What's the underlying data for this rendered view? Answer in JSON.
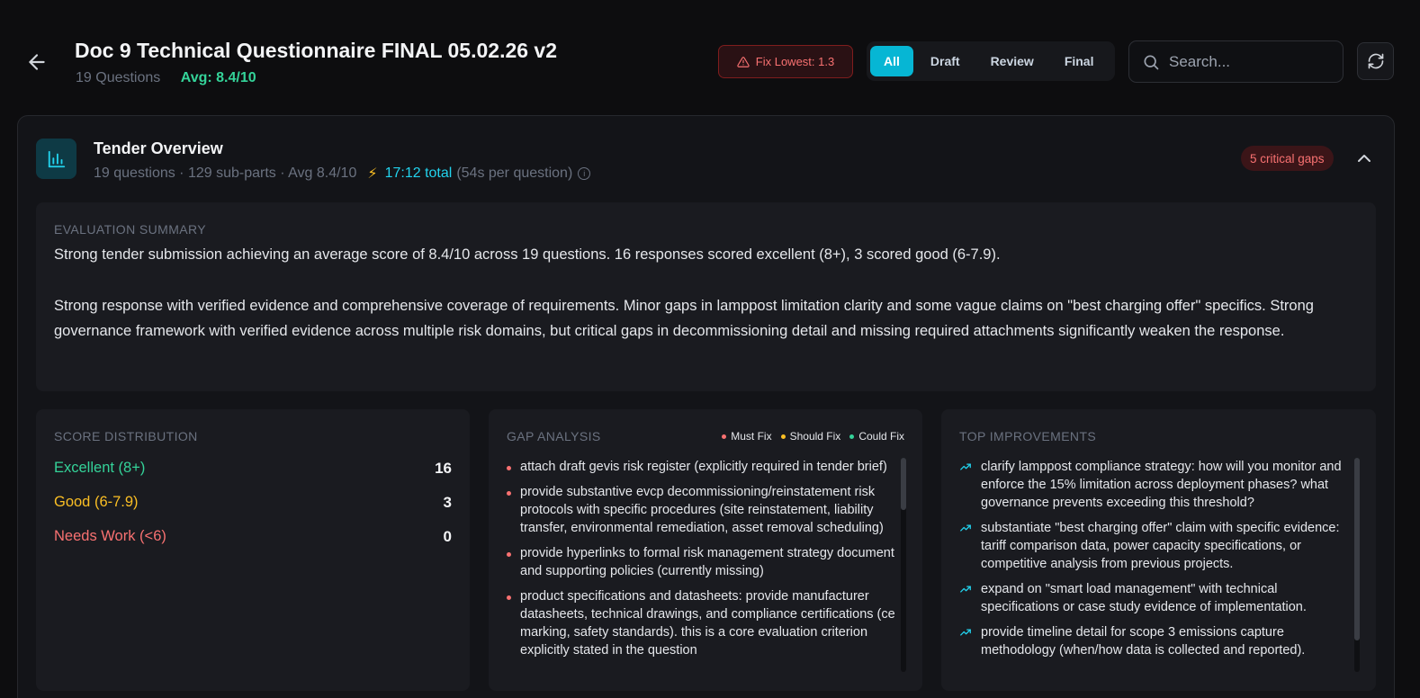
{
  "header": {
    "title": "Doc 9 Technical Questionnaire FINAL 05.02.26 v2",
    "question_count": "19 Questions",
    "avg": "Avg: 8.4/10",
    "fix_lowest": "Fix Lowest: 1.3",
    "filters": [
      "All",
      "Draft",
      "Review",
      "Final"
    ],
    "active_filter": "All",
    "search_placeholder": "Search..."
  },
  "overview": {
    "title": "Tender Overview",
    "meta": "19 questions · 129 sub-parts · Avg 8.4/10",
    "total_time": "17:12 total",
    "per_question": "(54s per question)",
    "critical_gaps": "5 critical gaps"
  },
  "summary": {
    "label": "EVALUATION SUMMARY",
    "paragraph1": "Strong tender submission achieving an average score of 8.4/10 across 19 questions. 16 responses scored excellent (8+), 3 scored good (6-7.9).",
    "paragraph2": "Strong response with verified evidence and comprehensive coverage of requirements. Minor gaps in lamppost limitation clarity and some vague claims on \"best charging offer\" specifics. Strong governance framework with verified evidence across multiple risk domains, but critical gaps in decommissioning detail and missing required attachments significantly weaken the response."
  },
  "score_distribution": {
    "label": "SCORE DISTRIBUTION",
    "rows": [
      {
        "name": "Excellent (8+)",
        "value": "16",
        "color": "#34d399"
      },
      {
        "name": "Good (6-7.9)",
        "value": "3",
        "color": "#fbbf24"
      },
      {
        "name": "Needs Work (<6)",
        "value": "0",
        "color": "#f87171"
      }
    ]
  },
  "gap_analysis": {
    "label": "GAP ANALYSIS",
    "legend": [
      {
        "name": "Must Fix",
        "color": "#f87171"
      },
      {
        "name": "Should Fix",
        "color": "#fbbf24"
      },
      {
        "name": "Could Fix",
        "color": "#34d399"
      }
    ],
    "items": [
      "attach draft gevis risk register (explicitly required in tender brief)",
      "provide substantive evcp decommissioning/reinstatement risk protocols with specific procedures (site reinstatement, liability transfer, environmental remediation, asset removal scheduling)",
      "provide hyperlinks to formal risk management strategy document and supporting policies (currently missing)",
      "product specifications and datasheets: provide manufacturer datasheets, technical drawings, and compliance certifications (ce marking, safety standards). this is a core evaluation criterion explicitly stated in the question"
    ]
  },
  "top_improvements": {
    "label": "TOP IMPROVEMENTS",
    "items": [
      "clarify lamppost compliance strategy: how will you monitor and enforce the 15% limitation across deployment phases? what governance prevents exceeding this threshold?",
      "substantiate \"best charging offer\" claim with specific evidence: tariff comparison data, power capacity specifications, or competitive analysis from previous projects.",
      "expand on \"smart load management\" with technical specifications or case study evidence of implementation.",
      "provide timeline detail for scope 3 emissions capture methodology (when/how data is collected and reported)."
    ]
  }
}
